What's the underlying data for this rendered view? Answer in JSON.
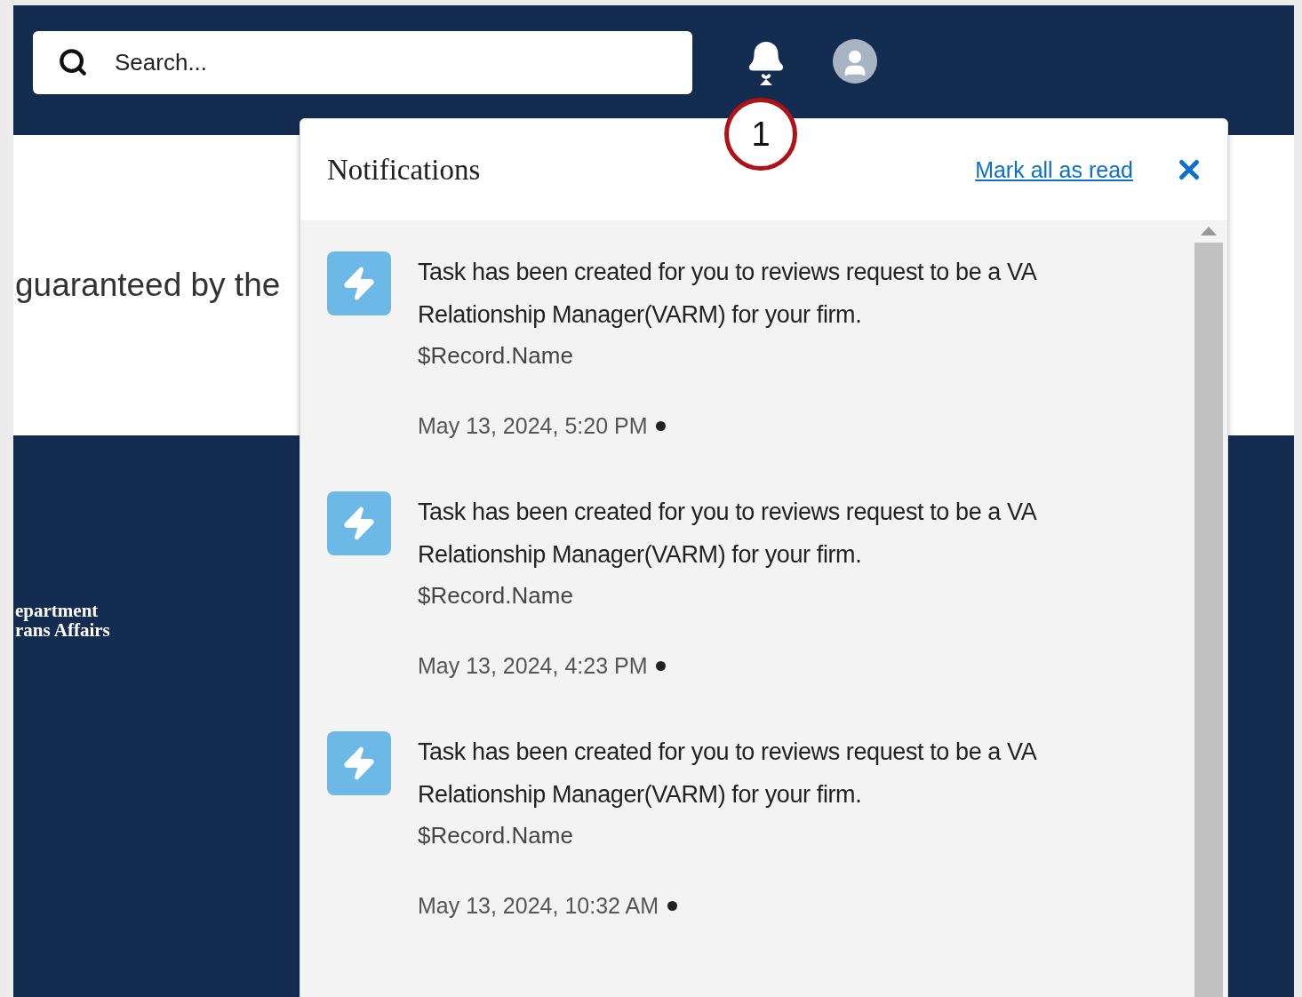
{
  "header": {
    "search": {
      "placeholder": "Search..."
    }
  },
  "page": {
    "body_text": "guaranteed by the",
    "footer_logo_lines": [
      "epartment",
      "rans Affairs"
    ]
  },
  "callout": "1",
  "notifications": {
    "title": "Notifications",
    "mark_all": "Mark all as read",
    "items": [
      {
        "text": "Task has been created for you to reviews request to be a VA Relationship Manager(VARM) for your firm.",
        "record": "$Record.Name",
        "time": "May 13, 2024, 5:20 PM",
        "unread": true
      },
      {
        "text": "Task has been created for you to reviews request to be a VA Relationship Manager(VARM) for your firm.",
        "record": "$Record.Name",
        "time": "May 13, 2024, 4:23 PM",
        "unread": true
      },
      {
        "text": "Task has been created for you to reviews request to be a VA Relationship Manager(VARM) for your firm.",
        "record": "$Record.Name",
        "time": "May 13, 2024, 10:32 AM",
        "unread": true
      }
    ]
  }
}
